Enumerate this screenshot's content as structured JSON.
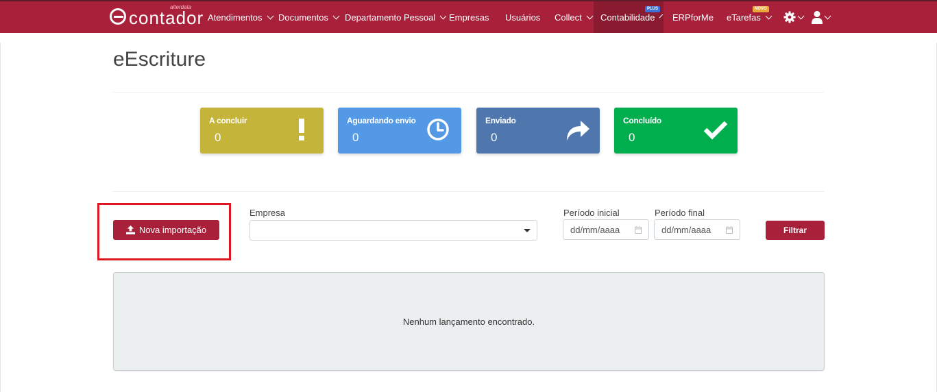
{
  "nav": {
    "brand": "contador",
    "brand_sub": "alterdata",
    "items": [
      {
        "label": "Atendimentos",
        "dropdown": true
      },
      {
        "label": "Documentos",
        "dropdown": true
      },
      {
        "label": "Departamento Pessoal",
        "dropdown": true
      },
      {
        "label": "Empresas",
        "dropdown": false
      },
      {
        "label": "Usuários",
        "dropdown": false
      },
      {
        "label": "Collect",
        "dropdown": true
      },
      {
        "label": "Contabilidade",
        "dropdown": true,
        "badge": "PLUS",
        "active": true
      },
      {
        "label": "ERPforMe",
        "dropdown": false
      },
      {
        "label": "eTarefas",
        "dropdown": true,
        "badge": "NOVO"
      }
    ],
    "icons": [
      "gear-icon",
      "user-icon"
    ]
  },
  "page": {
    "title": "eEscriture"
  },
  "cards": [
    {
      "label": "A concluir",
      "value": "0",
      "icon": "exclamation-icon",
      "color": "#c5b43a"
    },
    {
      "label": "Aguardando envio",
      "value": "0",
      "icon": "clock-icon",
      "color": "#5499e5"
    },
    {
      "label": "Enviado",
      "value": "0",
      "icon": "share-arrow-icon",
      "color": "#5077ad"
    },
    {
      "label": "Concluído",
      "value": "0",
      "icon": "check-icon",
      "color": "#00ae4e"
    }
  ],
  "filters": {
    "new_import_label": "Nova importação",
    "empresa_label": "Empresa",
    "empresa_value": "",
    "periodo_inicial_label": "Período inicial",
    "periodo_final_label": "Período final",
    "date_placeholder": "dd/mm/aaaa",
    "filter_button": "Filtrar"
  },
  "results": {
    "empty_message": "Nenhum lançamento encontrado."
  },
  "colors": {
    "brand": "#a8203a",
    "highlight": "#e0161f"
  }
}
